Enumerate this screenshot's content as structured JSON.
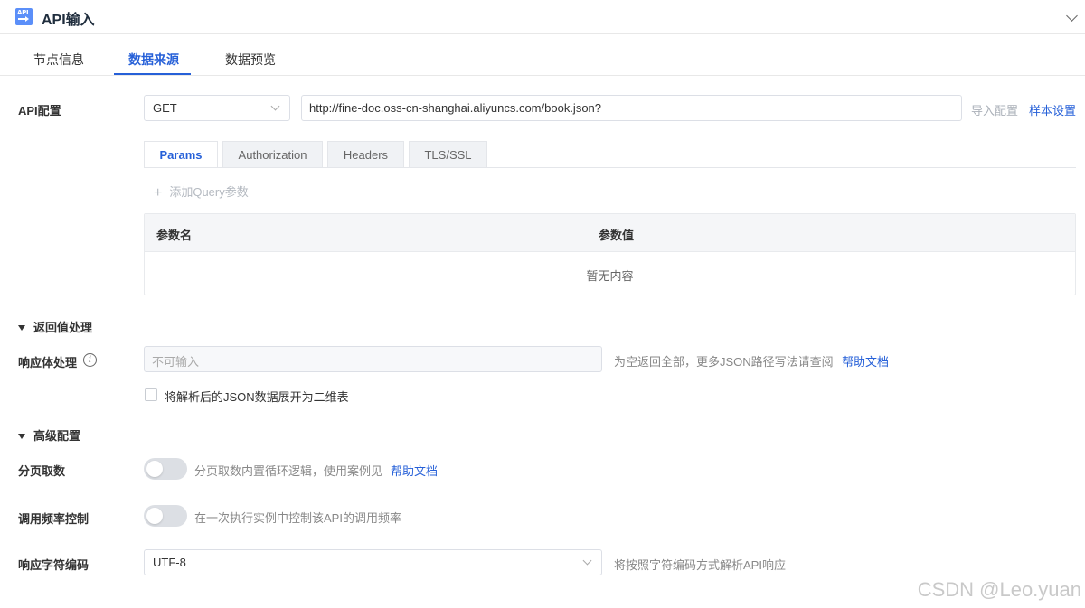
{
  "header": {
    "icon_text": "API",
    "title": "API输入"
  },
  "tabs": [
    {
      "label": "节点信息",
      "active": false
    },
    {
      "label": "数据来源",
      "active": true
    },
    {
      "label": "数据预览",
      "active": false
    }
  ],
  "api_config": {
    "label": "API配置",
    "method": "GET",
    "url": "http://fine-doc.oss-cn-shanghai.aliyuncs.com/book.json?",
    "import_link": "导入配置",
    "sample_link": "样本设置"
  },
  "sub_tabs": [
    {
      "label": "Params",
      "active": true
    },
    {
      "label": "Authorization",
      "active": false
    },
    {
      "label": "Headers",
      "active": false
    },
    {
      "label": "TLS/SSL",
      "active": false
    }
  ],
  "params": {
    "add_label": "添加Query参数",
    "columns": [
      "参数名",
      "参数值"
    ],
    "empty_text": "暂无内容"
  },
  "return_section": {
    "title": "返回值处理",
    "body_label": "响应体处理",
    "body_placeholder": "不可输入",
    "body_hint": "为空返回全部，更多JSON路径写法请查阅",
    "body_help_link": "帮助文档",
    "expand_checkbox_label": "将解析后的JSON数据展开为二维表",
    "expand_checked": false
  },
  "advanced_section": {
    "title": "高级配置",
    "paging_label": "分页取数",
    "paging_enabled": false,
    "paging_hint": "分页取数内置循环逻辑，使用案例见",
    "paging_help_link": "帮助文档",
    "rate_label": "调用频率控制",
    "rate_enabled": false,
    "rate_hint": "在一次执行实例中控制该API的调用频率",
    "encoding_label": "响应字符编码",
    "encoding_value": "UTF-8",
    "encoding_hint": "将按照字符编码方式解析API响应"
  },
  "watermark": "CSDN @Leo.yuan",
  "colors": {
    "accent": "#2660d8",
    "border": "#dcdfe6",
    "muted": "#888888"
  }
}
